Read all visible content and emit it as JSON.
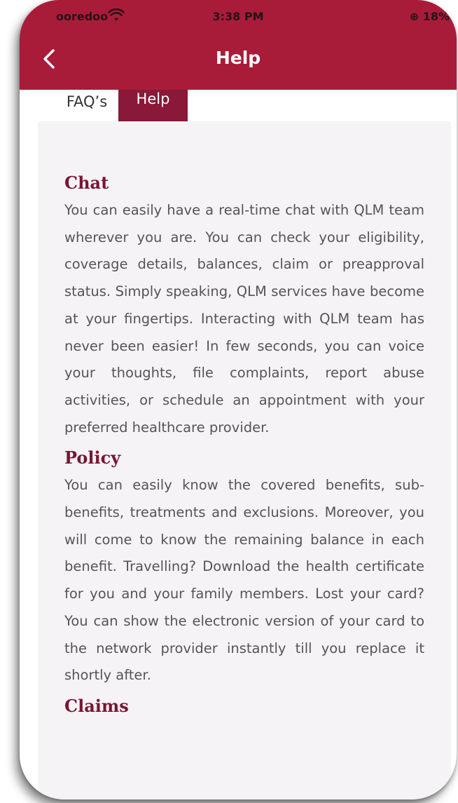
{
  "status_bar": {
    "carrier": "ooredoo",
    "time": "3:38 PM",
    "battery": "18%"
  },
  "header": {
    "title": "Help",
    "back_icon": "chevron-left-icon"
  },
  "tabs": [
    {
      "label": "FAQ’s",
      "active": false
    },
    {
      "label": "Help",
      "active": true
    }
  ],
  "sections": [
    {
      "title": "Chat",
      "body": "You can easily have a real-time chat with QLM team wherever you are. You can check your eligibility, coverage details, balances, claim or preapproval status. Simply speaking, QLM services have become at your fingertips. Interacting with QLM team has never been easier! In few seconds, you can voice your thoughts, file complaints, report abuse activities, or schedule an appointment with your preferred healthcare provider."
    },
    {
      "title": "Policy",
      "body": "You can easily know the covered benefits, sub-benefits, treatments and exclusions. Moreover, you will come to know the remaining balance in each benefit. Travelling? Download the health certificate for you and your family members. Lost your card? You can show the electronic version of your card to the network provider instantly till you replace it shortly after."
    },
    {
      "title": "Claims",
      "body": ""
    }
  ],
  "colors": {
    "header": "#a81c3a",
    "active_tab": "#8a1838",
    "section_title": "#7a1533",
    "card_bg": "#f5f3f5"
  }
}
